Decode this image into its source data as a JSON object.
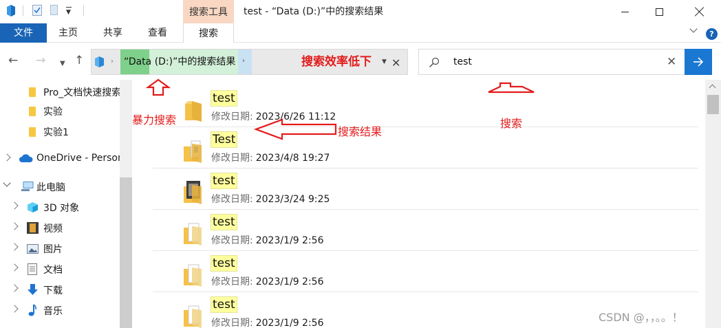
{
  "window": {
    "title": "test - “Data (D:)”中的搜索结果",
    "contextual_group": "搜索工具"
  },
  "ribbon": {
    "tabs": [
      "文件",
      "主页",
      "共享",
      "查看",
      "搜索"
    ],
    "active_tab": "搜索",
    "help_label": "?"
  },
  "address_bar": {
    "path_label": "“Data (D:)”中的搜索结果",
    "clear_icon": "close-icon"
  },
  "search_box": {
    "value": "test"
  },
  "nav_pane": {
    "items": [
      {
        "label": "Pro_文档快速搜索",
        "icon": "folder-icon"
      },
      {
        "label": "实验",
        "icon": "folder-icon"
      },
      {
        "label": "实验1",
        "icon": "folder-icon"
      },
      {
        "label": "OneDrive - Personal",
        "icon": "cloud-icon"
      },
      {
        "label": "此电脑",
        "icon": "computer-icon"
      },
      {
        "label": "3D 对象",
        "icon": "cube-icon"
      },
      {
        "label": "视频",
        "icon": "video-icon"
      },
      {
        "label": "图片",
        "icon": "picture-icon"
      },
      {
        "label": "文档",
        "icon": "document-icon"
      },
      {
        "label": "下载",
        "icon": "download-icon"
      },
      {
        "label": "音乐",
        "icon": "music-icon"
      }
    ]
  },
  "results": {
    "date_label": "修改日期:",
    "items": [
      {
        "name": "test",
        "modified": "2023/6/26 11:12",
        "icon": "folder-icon"
      },
      {
        "name": "Test",
        "modified": "2023/4/8 19:27",
        "icon": "folder-with-file-icon"
      },
      {
        "name": "test",
        "modified": "2023/3/24 9:25",
        "icon": "folder-with-image-icon"
      },
      {
        "name": "test",
        "modified": "2023/1/9 2:56",
        "icon": "folder-with-page-icon"
      },
      {
        "name": "test",
        "modified": "2023/1/9 2:56",
        "icon": "folder-with-page-icon"
      },
      {
        "name": "test",
        "modified": "2023/1/9 2:56",
        "icon": "folder-with-page-icon"
      }
    ]
  },
  "annotations": {
    "inefficient": "搜索效率低下",
    "brute_force": "暴力搜索",
    "search_results": "搜索结果",
    "search": "搜索",
    "color": "#e31b1b"
  },
  "watermark": "CSDN @，，。。！",
  "colors": {
    "file_tab": "#1964b6",
    "search_tools_tab": "#f9d7c3",
    "search_button": "#1a77d2",
    "highlight": "#ffff9e"
  }
}
